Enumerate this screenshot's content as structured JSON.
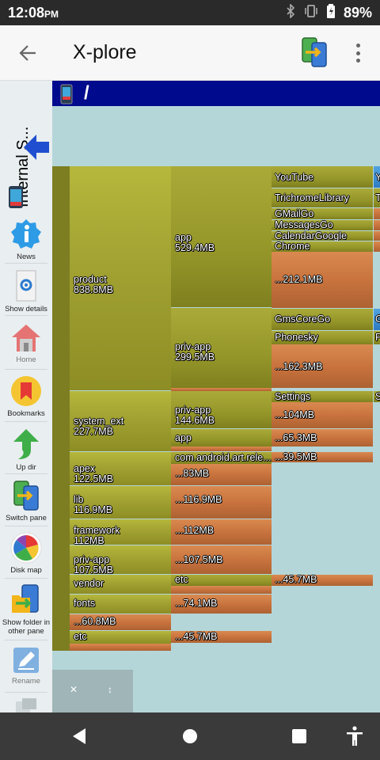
{
  "status": {
    "time": "12:08",
    "ampm": "PM",
    "battery": "89%"
  },
  "app": {
    "title": "X-plore"
  },
  "pane": {
    "label": "Internal S...",
    "path": "/"
  },
  "sidebar": [
    {
      "label": "News",
      "icon": "info-icon"
    },
    {
      "label": "Show details",
      "icon": "details-icon"
    },
    {
      "label": "Home",
      "icon": "home-icon"
    },
    {
      "label": "Bookmarks",
      "icon": "bookmark-icon"
    },
    {
      "label": "Up dir",
      "icon": "up-arrow-icon"
    },
    {
      "label": "Switch pane",
      "icon": "switch-pane-icon"
    },
    {
      "label": "Disk map",
      "icon": "disk-map-icon"
    },
    {
      "label": "Show folder in other pane",
      "icon": "show-folder-icon"
    },
    {
      "label": "Rename",
      "icon": "rename-icon"
    }
  ],
  "diskmap": {
    "col1": [
      {
        "name": "product",
        "size": "838.8MB"
      },
      {
        "name": "system_ext",
        "size": "227.7MB"
      },
      {
        "name": "apex",
        "size": "122.5MB"
      },
      {
        "name": "lib",
        "size": "116.9MB"
      },
      {
        "name": "framework",
        "size": "112MB"
      },
      {
        "name": "priv-app",
        "size": "107.5MB"
      },
      {
        "name": "vendor"
      },
      {
        "name": "fonts"
      },
      {
        "name": "...",
        "size": "60.8MB"
      },
      {
        "name": "etc"
      }
    ],
    "col2": [
      {
        "name": "app",
        "size": "529.4MB"
      },
      {
        "name": "priv-app",
        "size": "299.5MB"
      },
      {
        "name": "priv-app",
        "size": "144.6MB"
      },
      {
        "name": "app"
      },
      {
        "name": "com.android.art.rele..."
      },
      {
        "name": "...",
        "size": "83MB"
      },
      {
        "name": "...",
        "size": "116.9MB"
      },
      {
        "name": "...",
        "size": "112MB"
      },
      {
        "name": "...",
        "size": "107.5MB"
      },
      {
        "name": "etc"
      },
      {
        "name": "...",
        "size": "74.1MB"
      },
      {
        "name": "...",
        "size": "45.7MB"
      }
    ],
    "col3": [
      {
        "name": "YouTube"
      },
      {
        "name": "TrichromeLibrary"
      },
      {
        "name": "GMailGo"
      },
      {
        "name": "MessagesGo"
      },
      {
        "name": "CalendarGoogle"
      },
      {
        "name": "Chrome"
      },
      {
        "name": "...",
        "size": "212.1MB"
      },
      {
        "name": "GmsCoreGo"
      },
      {
        "name": "Phonesky"
      },
      {
        "name": "...",
        "size": "162.3MB"
      },
      {
        "name": "Settings"
      },
      {
        "name": "...",
        "size": "104MB"
      },
      {
        "name": "...",
        "size": "65.3MB"
      },
      {
        "name": "...",
        "size": "39.5MB"
      },
      {
        "name": "...",
        "size": "45.7MB"
      }
    ],
    "col4": [
      {
        "name": "Y"
      },
      {
        "name": "T"
      },
      {
        "name": "G"
      },
      {
        "name": "P"
      },
      {
        "name": "S"
      }
    ]
  },
  "colors": {
    "path_bar": "#000a8c",
    "map_bg": "#b4d6d9",
    "folder": "#a3a433",
    "file": "#c9733e"
  }
}
